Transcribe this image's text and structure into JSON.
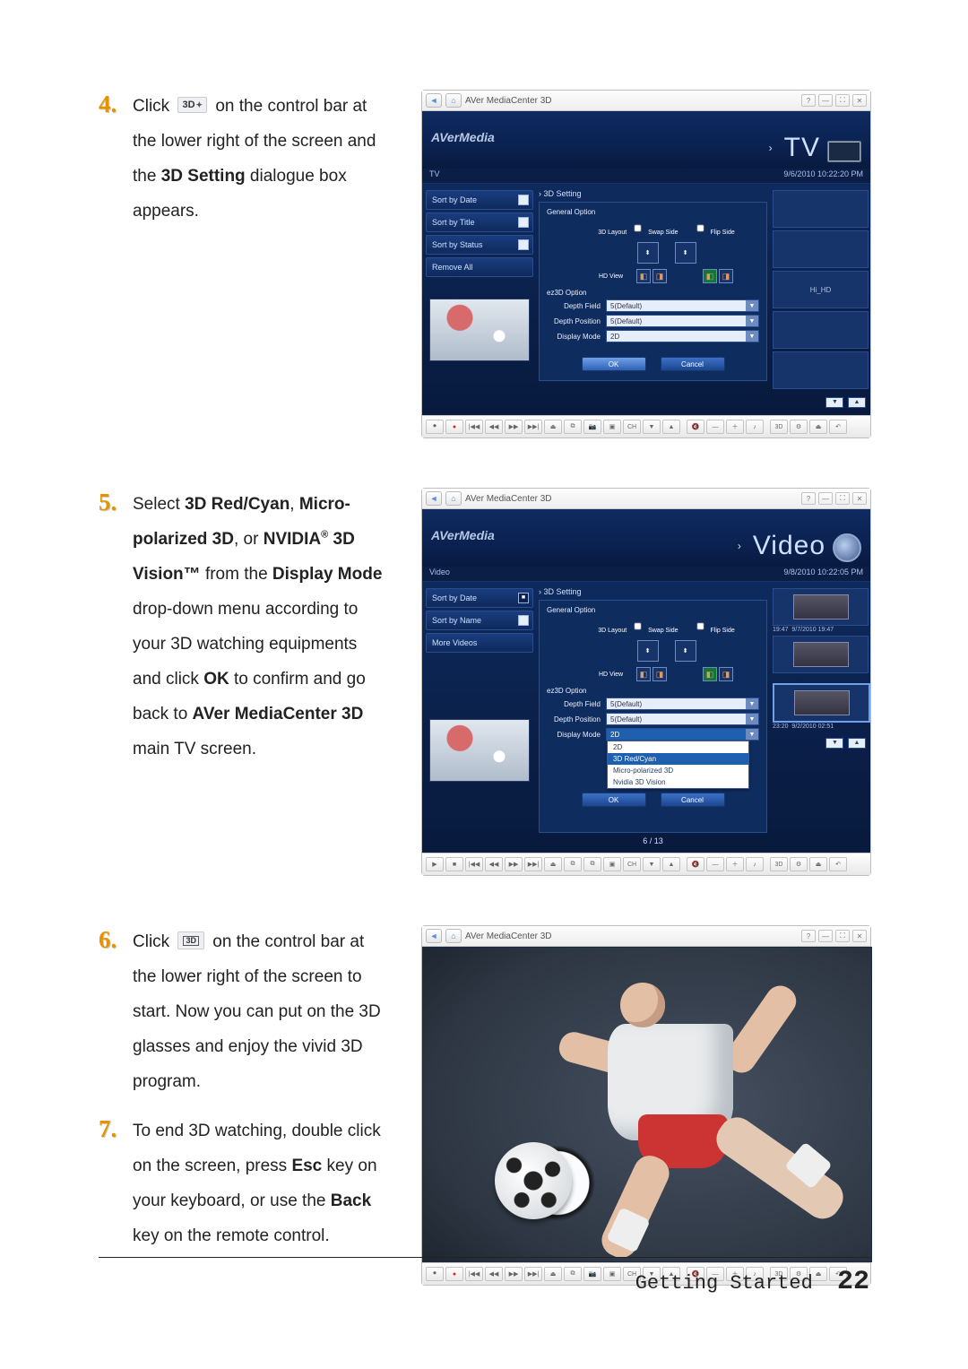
{
  "steps": {
    "s4": {
      "num": "4.",
      "icon": "3D",
      "text_a": "Click",
      "text_b": "on the control bar at the lower right of the screen and the ",
      "bold1": "3D Setting",
      "text_c": " dialogue box appears."
    },
    "s5": {
      "num": "5.",
      "text_a": "Select ",
      "bold1": "3D Red/Cyan",
      "text_b": ", ",
      "bold2": "Micro-polarized 3D",
      "text_c": ", or ",
      "bold3": "NVIDIA",
      "sup": "®",
      "bold3b": " 3D Vision™",
      "text_d": " from the ",
      "bold4": "Display Mode",
      "text_e": " drop-down menu according to your 3D watching equipments and click ",
      "bold5": "OK",
      "text_f": " to confirm and go back to ",
      "bold6": "AVer MediaCenter 3D",
      "text_g": " main TV screen."
    },
    "s6": {
      "num": "6.",
      "icon": "3D",
      "text_a": "Click",
      "text_b": "on the control bar at the lower right of the screen to start. Now you can put on the 3D glasses and enjoy the vivid 3D program."
    },
    "s7": {
      "num": "7.",
      "text_a": "To end 3D watching, double click on the screen, press ",
      "bold1": "Esc",
      "text_b": " key on your keyboard, or use the ",
      "bold2": "Back",
      "text_c": " key on the remote control."
    }
  },
  "appwin_title": "AVer MediaCenter 3D",
  "brand": "AVerMedia",
  "win1": {
    "hero_prefix": "›",
    "hero": "TV",
    "context_left": "TV",
    "date": "9/6/2010 10:22:20 PM",
    "sidebar": [
      "Sort by Date",
      "Sort by Title",
      "Sort by Status",
      "Remove All"
    ],
    "crumb": "›  3D Setting",
    "sect_general": "General Option",
    "lbl_layout": "3D Layout",
    "chk_swap": "Swap Side",
    "chk_flip": "Flip Side",
    "lbl_hdview": "HD View",
    "sect_ez3d": "ez3D Option",
    "row_depth": "Depth Field",
    "row_depth_val": "5(Default)",
    "row_pos": "Depth Position",
    "row_pos_val": "5(Default)",
    "row_mode": "Display Mode",
    "row_mode_val": "2D",
    "ok": "OK",
    "cancel": "Cancel",
    "right_label": "Hi_HD",
    "pager": [
      "▼",
      "▲"
    ],
    "cbar": [
      "⏺",
      "●",
      "|◀◀",
      "◀◀",
      "▶▶",
      "▶▶|",
      "⏏",
      "⧉",
      "📷",
      "▣",
      "CH",
      "▼",
      "▲",
      "",
      "🔇",
      "—",
      "＋",
      "♪",
      "",
      "3D",
      "⚙",
      "⏏",
      "↶"
    ]
  },
  "win2": {
    "hero_prefix": "›",
    "hero": "Video",
    "context_left": "Video",
    "date": "9/8/2010 10:22:05 PM",
    "sidebar": [
      "Sort by Date",
      "Sort by Name",
      "More Videos"
    ],
    "crumb": "›  3D Setting",
    "dd_open": [
      "2D",
      "3D Red/Cyan",
      "Micro-polarized 3D",
      "Nvidia 3D Vision"
    ],
    "dd_selected": "2D",
    "ok": "OK",
    "cancel": "Cancel",
    "pagenum": "6 / 13",
    "thumbs": [
      {
        "time": "19:47",
        "date": "9/7/2010 19:47"
      },
      {
        "time": "",
        "date": ""
      },
      {
        "time": "23:20",
        "date": "9/2/2010 02:51"
      }
    ],
    "pager": [
      "▼",
      "▲"
    ],
    "cbar": [
      "▶",
      "■",
      "|◀◀",
      "◀◀",
      "▶▶",
      "▶▶|",
      "⏏",
      "⧉",
      "⧉",
      "▣",
      "CH",
      "▼",
      "▲",
      "",
      "🔇",
      "—",
      "＋",
      "♪",
      "",
      "3D",
      "⚙",
      "⏏",
      "↶"
    ]
  },
  "win3": {
    "cbar": [
      "⏺",
      "●",
      "|◀◀",
      "◀◀",
      "▶▶",
      "▶▶|",
      "⏏",
      "⧉",
      "📷",
      "▣",
      "CH",
      "▼",
      "▲",
      "",
      "🔇",
      "—",
      "＋",
      "♪",
      "",
      "3D",
      "⚙",
      "⏏",
      "↶"
    ]
  },
  "footer": {
    "section": "Getting Started",
    "page": "22"
  }
}
